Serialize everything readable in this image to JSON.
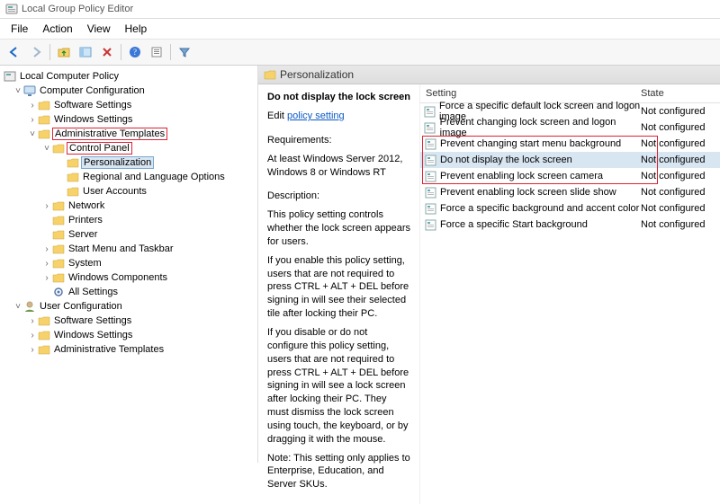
{
  "window": {
    "title": "Local Group Policy Editor"
  },
  "menus": [
    "File",
    "Action",
    "View",
    "Help"
  ],
  "tree": {
    "root": "Local Computer Policy",
    "cconf": "Computer Configuration",
    "soft": "Software Settings",
    "win": "Windows Settings",
    "admin": "Administrative Templates",
    "cp": "Control Panel",
    "pers": "Personalization",
    "rlang": "Regional and Language Options",
    "uacc": "User Accounts",
    "net": "Network",
    "prn": "Printers",
    "srv": "Server",
    "smtb": "Start Menu and Taskbar",
    "sys": "System",
    "wcomp": "Windows Components",
    "alls": "All Settings",
    "uconf": "User Configuration",
    "usoft": "Software Settings",
    "uwin": "Windows Settings",
    "uadmin": "Administrative Templates"
  },
  "crumb": "Personalization",
  "desc": {
    "title": "Do not display the lock screen",
    "edit_prefix": "Edit",
    "edit_link": "policy setting",
    "req_label": "Requirements:",
    "req_text": "At least Windows Server 2012, Windows 8 or Windows RT",
    "d_label": "Description:",
    "d_text": "This policy setting controls whether the lock screen appears for users.",
    "p2": "If you enable this policy setting, users that are not required to press CTRL + ALT + DEL before signing in will see their selected tile after locking their PC.",
    "p3": "If you disable or do not configure this policy setting, users that are not required to press CTRL + ALT + DEL before signing in will see a lock screen after locking their PC. They must dismiss the lock screen using touch, the keyboard, or by dragging it with the mouse.",
    "p4": "Note: This setting only applies to Enterprise, Education, and Server SKUs."
  },
  "list": {
    "col1": "Setting",
    "col2": "State",
    "rows": [
      {
        "name": "Force a specific default lock screen and logon image",
        "state": "Not configured"
      },
      {
        "name": "Prevent changing lock screen and logon image",
        "state": "Not configured"
      },
      {
        "name": "Prevent changing start menu background",
        "state": "Not configured"
      },
      {
        "name": "Do not display the lock screen",
        "state": "Not configured"
      },
      {
        "name": "Prevent enabling lock screen camera",
        "state": "Not configured"
      },
      {
        "name": "Prevent enabling lock screen slide show",
        "state": "Not configured"
      },
      {
        "name": "Force a specific background and accent color",
        "state": "Not configured"
      },
      {
        "name": "Force a specific Start background",
        "state": "Not configured"
      }
    ]
  }
}
